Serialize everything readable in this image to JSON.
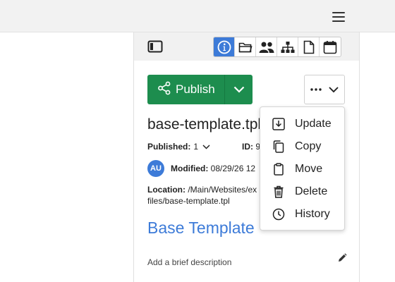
{
  "header": {
    "menu_icon": "hamburger-icon"
  },
  "toolbar": {
    "toggle_icon": "sidebar-toggle-icon",
    "tabs": [
      {
        "icon": "info-icon",
        "active": true
      },
      {
        "icon": "folder-icon",
        "active": false
      },
      {
        "icon": "users-icon",
        "active": false
      },
      {
        "icon": "sitemap-icon",
        "active": false
      },
      {
        "icon": "file-icon",
        "active": false
      },
      {
        "icon": "calendar-icon",
        "active": false
      }
    ]
  },
  "actions": {
    "publish_label": "Publish",
    "more_icon": "ellipsis-icon"
  },
  "asset": {
    "name": "base-template.tpl",
    "published_label": "Published:",
    "published_value": "1",
    "id_label": "ID:",
    "id_value": "9",
    "avatar_initials": "AU",
    "modified_label": "Modified:",
    "modified_value": "08/29/26 12",
    "location_label": "Location:",
    "location_path": "/Main/Websites/ex",
    "location_path_cont": "files/base-template.tpl",
    "display_title": "Base Template",
    "description_placeholder": "Add a brief description"
  },
  "menu": {
    "items": [
      {
        "label": "Update",
        "icon": "update-icon"
      },
      {
        "label": "Copy",
        "icon": "copy-icon"
      },
      {
        "label": "Move",
        "icon": "move-icon"
      },
      {
        "label": "Delete",
        "icon": "delete-icon"
      },
      {
        "label": "History",
        "icon": "history-icon"
      }
    ]
  },
  "colors": {
    "publish_green": "#1d8d4e",
    "accent_blue": "#3d7bd8",
    "toolbar_bg": "#f1f1f1"
  }
}
